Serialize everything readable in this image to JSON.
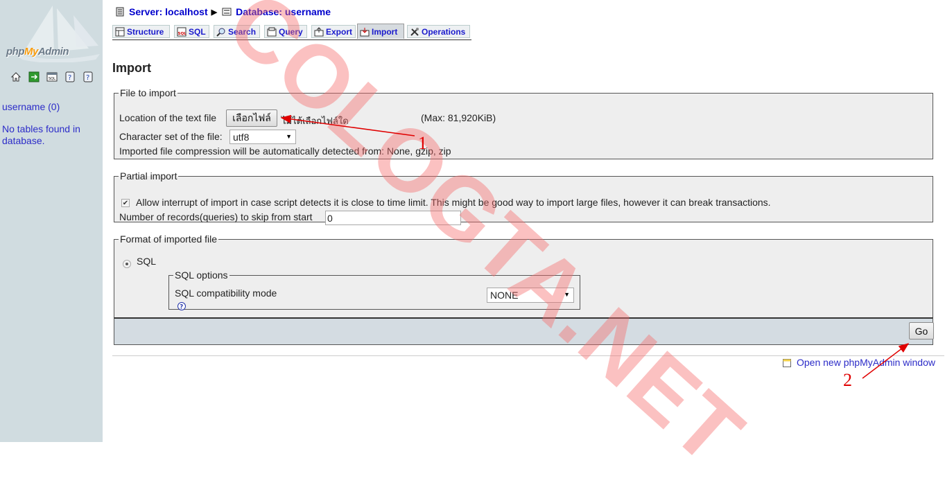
{
  "nav": {
    "logo": {
      "php": "php",
      "my": "My",
      "admin": "Admin"
    },
    "icons": [
      "home-icon",
      "exit-icon",
      "sql-query-icon",
      "documentation-icon",
      "sql-docs-icon"
    ],
    "database": "username (0)",
    "empty_message": "No tables found in database."
  },
  "breadcrumb": {
    "server": "Server: localhost",
    "database": "Database: username"
  },
  "tabs": [
    {
      "label": "Structure",
      "icon": "structure-icon"
    },
    {
      "label": "SQL",
      "icon": "sql-icon"
    },
    {
      "label": "Search",
      "icon": "search-icon"
    },
    {
      "label": "Query",
      "icon": "query-icon"
    },
    {
      "label": "Export",
      "icon": "export-icon"
    },
    {
      "label": "Import",
      "icon": "import-icon",
      "active": true
    },
    {
      "label": "Operations",
      "icon": "operations-icon"
    }
  ],
  "page_title": "Import",
  "file_to_import": {
    "legend": "File to import",
    "location_label": "Location of the text file",
    "choose_button": "เลือกไฟล์",
    "no_file": "ไม่ได้เลือกไฟล์ใด",
    "max_size": "(Max: 81,920KiB)",
    "charset_label": "Character set of the file:",
    "charset_value": "utf8",
    "compression_note": "Imported file compression will be automatically detected from: None, gzip, zip"
  },
  "partial_import": {
    "legend": "Partial import",
    "allow_interrupt_checked": true,
    "allow_interrupt_label": "Allow interrupt of import in case script detects it is close to time limit. This might be good way to import large files, however it can break transactions.",
    "skip_label": "Number of records(queries) to skip from start",
    "skip_value": "0"
  },
  "format": {
    "legend": "Format of imported file",
    "sql_label": "SQL",
    "sql_selected": true,
    "sql_options_legend": "SQL options",
    "compat_label": "SQL compatibility mode",
    "compat_value": "NONE",
    "help_icon": "help-icon"
  },
  "go_button": "Go",
  "open_new_window": "Open new phpMyAdmin window",
  "overlay": {
    "watermark": "COLOGTA.NET",
    "annotation_1": "1",
    "annotation_2": "2",
    "color": "#e00000"
  },
  "colors": {
    "nav_bg": "#d0dce0",
    "link": "#2c2cc8",
    "fieldset_bg": "#eeeeee",
    "go_bar_bg": "#d4dce2"
  }
}
